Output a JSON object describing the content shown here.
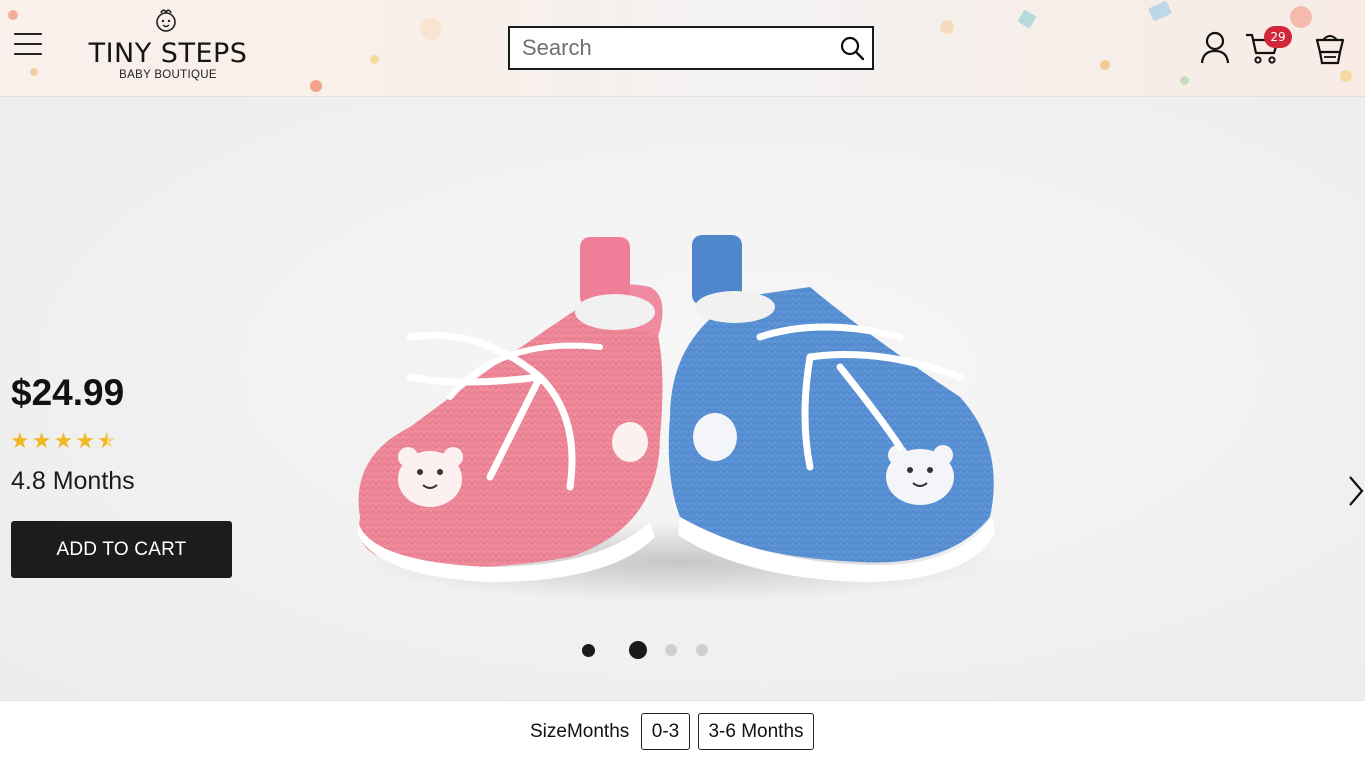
{
  "header": {
    "brand_name": "TINY STEPS",
    "brand_tagline": "BABY BOUTIQUE",
    "search_placeholder": "Search",
    "cart_count": "29",
    "icons": [
      "menu-icon",
      "search-icon",
      "user-icon",
      "cart-icon",
      "shopping-basket-icon"
    ]
  },
  "product": {
    "price": "$24.99",
    "rating_stars": 4.5,
    "rating_text": "4.8 Months",
    "add_to_cart_label": "ADD TO CART"
  },
  "carousel": {
    "slide_count": 4,
    "active_index": 1,
    "next_icon": "chevron-right-icon"
  },
  "size_selector": {
    "label": "SizeMonths",
    "options": [
      "0-3",
      "3-6 Months"
    ]
  },
  "colors": {
    "accent_dark": "#1c1c1c",
    "badge": "#d0283a",
    "star": "#f2b824"
  }
}
